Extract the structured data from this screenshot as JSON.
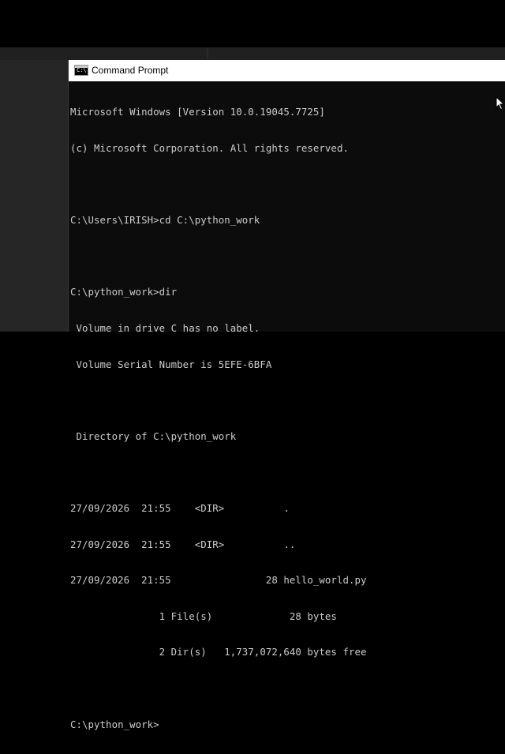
{
  "window": {
    "title": "Command Prompt",
    "icon": "command-prompt-icon"
  },
  "console": {
    "lines": [
      "Microsoft Windows [Version 10.0.19045.7725]",
      "(c) Microsoft Corporation. All rights reserved.",
      "",
      "C:\\Users\\IRISH>cd C:\\python_work",
      "",
      "C:\\python_work>dir",
      " Volume in drive C has no label.",
      " Volume Serial Number is 5EFE-6BFA",
      "",
      " Directory of C:\\python_work",
      "",
      "27/09/2026  21:55    <DIR>          .",
      "27/09/2026  21:55    <DIR>          ..",
      "27/09/2026  21:55                28 hello_world.py",
      "               1 File(s)             28 bytes",
      "               2 Dir(s)   1,737,072,640 bytes free",
      "",
      "C:\\python_work>"
    ]
  },
  "colors": {
    "console_bg": "#0c0c0c",
    "console_text": "#cccccc",
    "titlebar_bg": "#ffffff"
  }
}
